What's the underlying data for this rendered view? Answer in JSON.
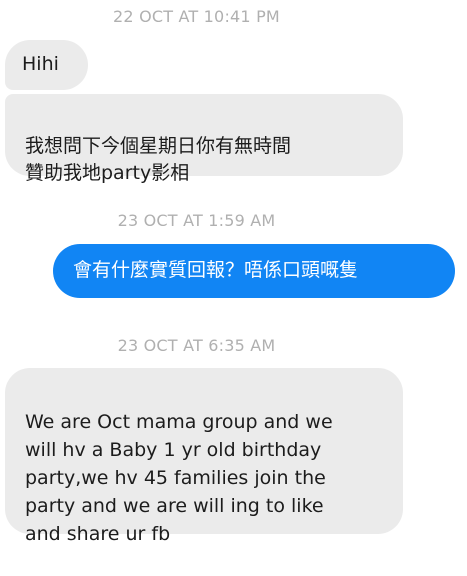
{
  "conversation": {
    "timestamps": [
      "22 OCT AT 10:41 PM",
      "23 OCT AT 1:59 AM",
      "23 OCT AT 6:35 AM"
    ],
    "messages": [
      {
        "direction": "incoming",
        "text": "Hihi"
      },
      {
        "direction": "incoming",
        "text": "我想問下今個星期日你有無時間\n贊助我地party影相"
      },
      {
        "direction": "outgoing",
        "text": "會有什麼實質回報？唔係口頭嘅隻"
      },
      {
        "direction": "incoming",
        "text": "We are Oct mama group and we\nwill hv a Baby 1 yr old birthday\nparty,we hv 45 families join the\nparty and we are will ing to like\nand share ur fb"
      }
    ]
  },
  "colors": {
    "incoming_bubble": "#ebebeb",
    "outgoing_bubble": "#1185f4",
    "timestamp_text": "#b0b0b0"
  }
}
